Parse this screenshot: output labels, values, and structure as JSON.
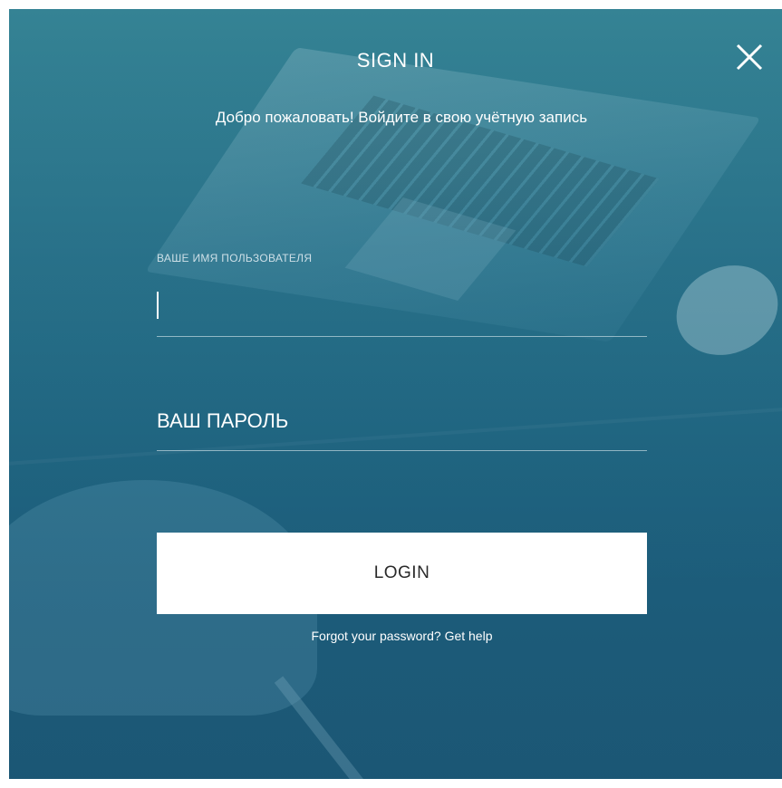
{
  "modal": {
    "title": "SIGN IN",
    "close_icon": "close-icon",
    "welcome_text": "Добро пожаловать! Войдите в свою учётную запись"
  },
  "form": {
    "username_label": "ВАШЕ ИМЯ ПОЛЬЗОВАТЕЛЯ",
    "username_value": "",
    "password_placeholder": "ВАШ ПАРОЛЬ",
    "login_label": "LOGIN",
    "forgot_question": "Forgot your password?",
    "get_help_label": "Get help"
  },
  "colors": {
    "background_top": "#3b8a9a",
    "background_bottom": "#1f5a78",
    "button_bg": "#ffffff",
    "text": "#ffffff"
  }
}
